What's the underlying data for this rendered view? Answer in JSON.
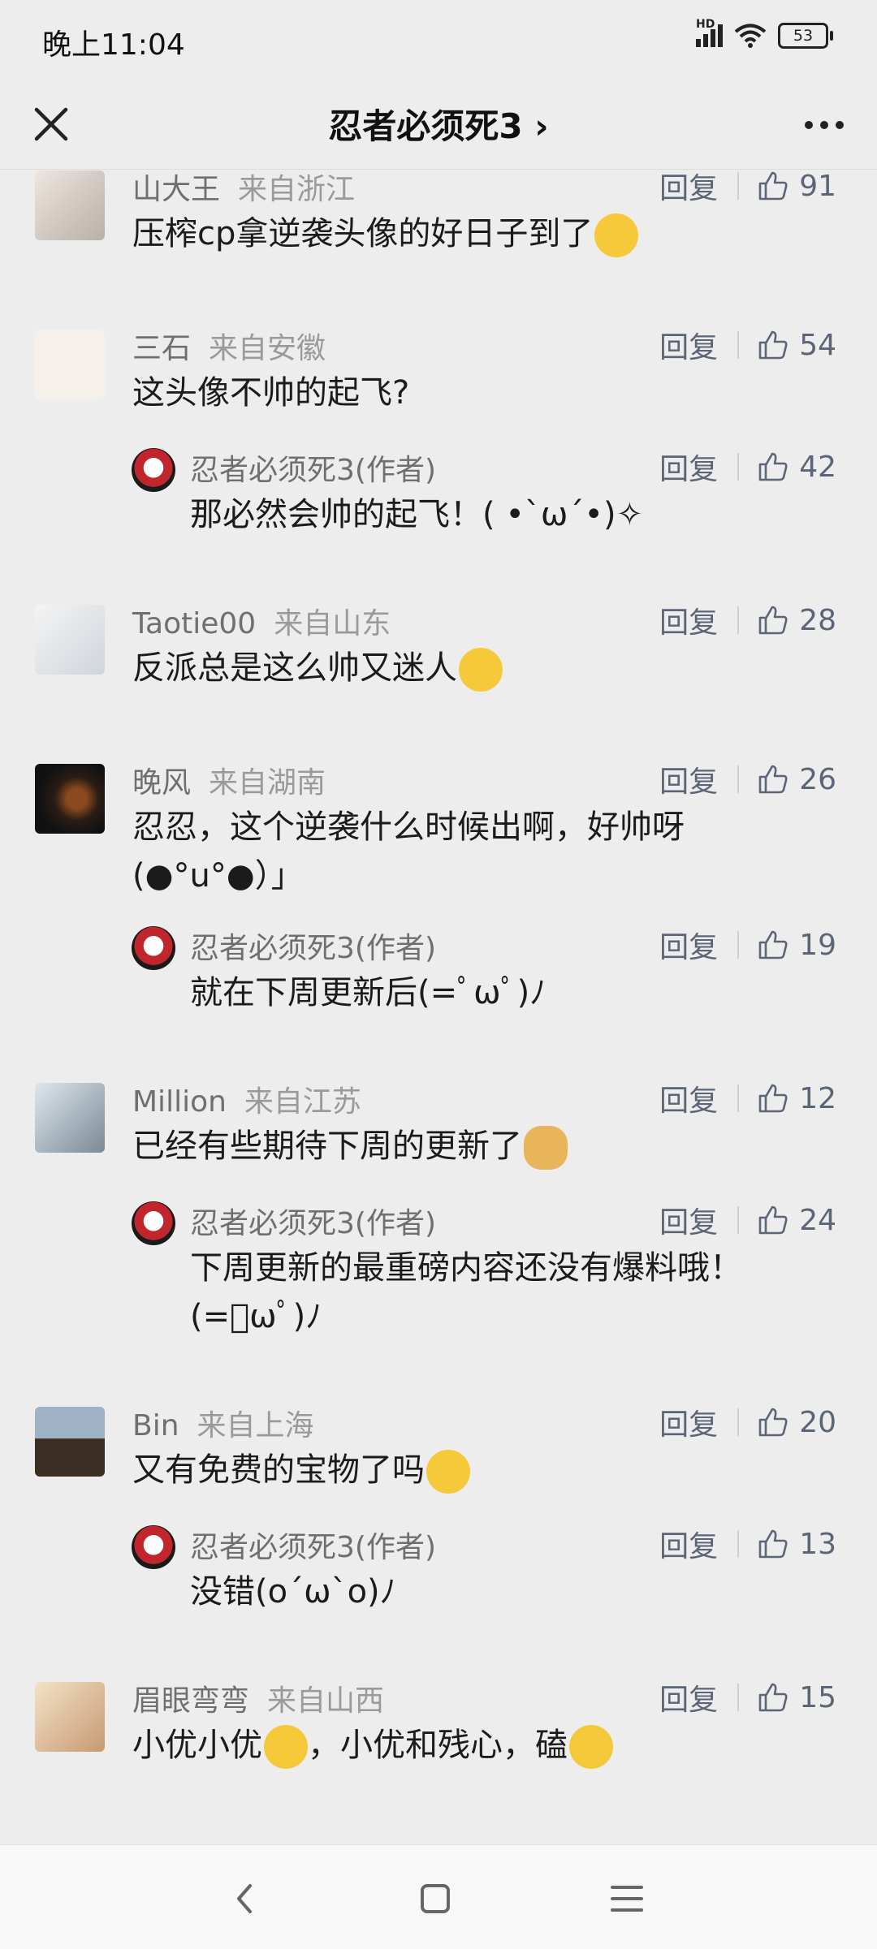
{
  "status": {
    "time": "晚上11:04",
    "network": "HD",
    "battery": "53"
  },
  "nav": {
    "title": "忍者必须死3 ›"
  },
  "reply_label": "回复",
  "comments": [
    {
      "name": "山大王",
      "location": "来自浙江",
      "text": "压榨cp拿逆袭头像的好日子到了",
      "likes": "91"
    },
    {
      "name": "三石",
      "location": "来自安徽",
      "text": "这头像不帅的起飞?",
      "likes": "54"
    },
    {
      "name": "忍者必须死3(作者)",
      "text": "那必然会帅的起飞！(  •`ω´•)✧",
      "likes": "42"
    },
    {
      "name": "Taotie00",
      "location": "来自山东",
      "text": "反派总是这么帅又迷人",
      "likes": "28"
    },
    {
      "name": "晚风",
      "location": "来自湖南",
      "text_line1": "忍忍，这个逆袭什么时候出啊，好帅呀",
      "text_line2": "(●°u°●）」",
      "likes": "26"
    },
    {
      "name": "忍者必须死3(作者)",
      "text": "就在下周更新后(=ﾟωﾟ)ﾉ",
      "likes": "19"
    },
    {
      "name": "Million",
      "location": "来自江苏",
      "text": "已经有些期待下周的更新了",
      "likes": "12"
    },
    {
      "name": "忍者必须死3(作者)",
      "text_line1": "下周更新的最重磅内容还没有爆料哦！",
      "text_line2": "(=ﾟωﾟ)ﾉ",
      "likes": "24"
    },
    {
      "name": "Bin",
      "location": "来自上海",
      "text": "又有免费的宝物了吗",
      "likes": "20"
    },
    {
      "name": "忍者必须死3(作者)",
      "text": "没错(o´ω`o)ﾉ",
      "likes": "13"
    },
    {
      "name": "眉眼弯弯",
      "location": "来自山西",
      "text_part1": "小优小优",
      "text_part2": "，小优和残心，磕",
      "likes": "15"
    }
  ],
  "icons": {
    "close": "close-icon",
    "more": "more-icon",
    "like": "thumbs-up-icon",
    "back": "back-icon",
    "home": "home-icon",
    "menu": "menu-icon"
  },
  "colors": {
    "background": "#ededed",
    "action": "#5c6577",
    "meta": "#9a9a9a"
  }
}
